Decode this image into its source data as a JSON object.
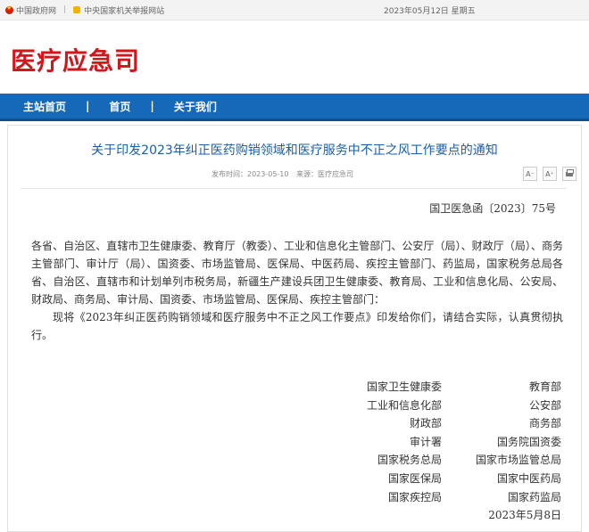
{
  "topbar": {
    "gov_link": "中国政府网",
    "report_link": "中央国家机关举报网站",
    "date": "2023年05月12日 星期五"
  },
  "header": {
    "logo": "医疗应急司"
  },
  "nav": {
    "items": [
      "主站首页",
      "首页",
      "关于我们"
    ],
    "separator": "|"
  },
  "article": {
    "title": "关于印发2023年纠正医药购销领域和医疗服务中不正之风工作要点的通知",
    "meta_date": "发布时间：2023-05-10",
    "meta_source": "来源：医疗应急司",
    "font_small": "A⁻",
    "font_large": "A⁺",
    "doc_number": "国卫医急函〔2023〕75号",
    "recipients": "各省、自治区、直辖市卫生健康委、教育厅（教委）、工业和信息化主管部门、公安厅（局）、财政厅（局）、商务主管部门、审计厅（局）、国资委、市场监管局、医保局、中医药局、疾控主管部门、药监局，国家税务总局各省、自治区、直辖市和计划单列市税务局，新疆生产建设兵团卫生健康委、教育局、工业和信息化局、公安局、财政局、商务局、审计局、国资委、市场监管局、医保局、疾控主管部门：",
    "body_text": "现将《2023年纠正医药购销领域和医疗服务中不正之风工作要点》印发给你们，请结合实际，认真贯彻执行。",
    "signatories": [
      [
        "国家卫生健康委",
        "教育部"
      ],
      [
        "工业和信息化部",
        "公安部"
      ],
      [
        "财政部",
        "商务部"
      ],
      [
        "审计署",
        "国务院国资委"
      ],
      [
        "国家税务总局",
        "国家市场监管总局"
      ],
      [
        "国家医保局",
        "国家中医药局"
      ],
      [
        "国家疾控局",
        "国家药监局"
      ]
    ],
    "sign_date": "2023年5月8日"
  },
  "colors": {
    "brand_red": "#d2161c",
    "nav_blue": "#1668b8",
    "title_blue": "#1a5fa8"
  }
}
